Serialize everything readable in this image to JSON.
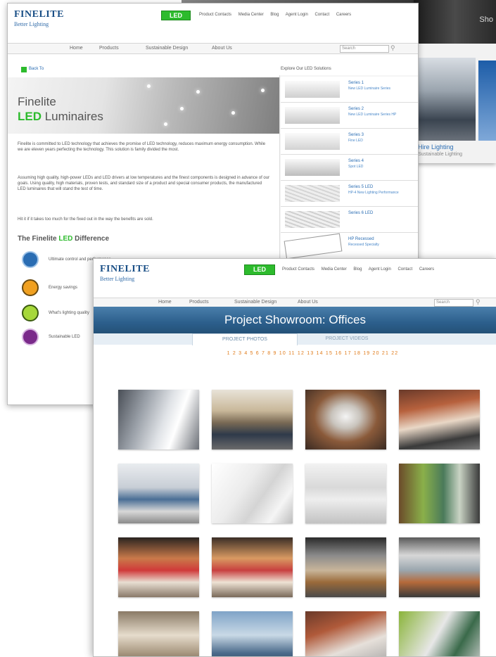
{
  "back_shot": {
    "heading": "Sho",
    "caption": "Hire Lighting",
    "caption_sub": "Sustainable Lighting"
  },
  "mid_shot": {
    "logo": "FINELITE",
    "logo_sub": "Better Lighting",
    "led_badge": "LED",
    "top_links": [
      "Product Contacts",
      "Media Center",
      "Blog",
      "Agent Login",
      "Contact",
      "Careers"
    ],
    "nav": [
      "Home",
      "Products",
      "Sustainable Design",
      "About Us"
    ],
    "search_placeholder": "Search",
    "breadcrumb": "Back To",
    "sidebar_title": "Explore Our LED Solutions",
    "hero_title_line1": "Finelite",
    "hero_title_line2a": "LED",
    "hero_title_line2b": " Luminaires",
    "para1": "Finelite is committed to LED technology that achieves the promise of LED technology, reduces maximum energy consumption. While we are eleven years perfecting the technology. This solution is family divided the most.",
    "para2": "Assuming high quality, high-power LEDs and LED drivers at low temperatures and the finest components is designed in advance of our goals. Using quality, high materials, proven tests, and standard size of a product and special consumer products, the manufactured LED luminaires that will stand the test of time.",
    "para3": "Hit it if it takes too much for the fixed out in the way the benefits are sold.",
    "difference_title_a": "The Finelite ",
    "difference_title_b": "LED",
    "difference_title_c": " Difference",
    "difference_items": [
      "Ultimate control and performance",
      "Energy savings",
      "What's lighting quality",
      "Sustainable LED"
    ],
    "products": [
      {
        "name": "Series 1",
        "desc": "New LED Luminaire Series"
      },
      {
        "name": "Series 2",
        "desc": "New LED Luminaire Series HP"
      },
      {
        "name": "Series 3",
        "desc": "Fine LED"
      },
      {
        "name": "Series 4",
        "desc": "Spot LED"
      },
      {
        "name": "Series 5 LED",
        "desc": "HP-4 New Lighting Performance"
      },
      {
        "name": "Series 6 LED",
        "desc": ""
      },
      {
        "name": "HP Recessed",
        "desc": "Recessed Specialty"
      }
    ]
  },
  "front_shot": {
    "logo": "FINELITE",
    "logo_sub": "Better Lighting",
    "led_badge": "LED",
    "top_links": [
      "Product Contacts",
      "Media Center",
      "Blog",
      "Agent Login",
      "Contact",
      "Careers"
    ],
    "nav": [
      "Home",
      "Products",
      "Sustainable Design",
      "About Us"
    ],
    "search_placeholder": "Search",
    "banner_title": "Project Showroom: Offices",
    "tab_active": "PROJECT PHOTOS",
    "tab_inactive": "PROJECT VIDEOS",
    "pages": "1 2 3 4 5 6 7 8 9 10 11 12 13 14 15 16 17 18 19 20 21 22",
    "accent_orange": "#e07b1a",
    "accent_blue": "#2c5f8c"
  }
}
